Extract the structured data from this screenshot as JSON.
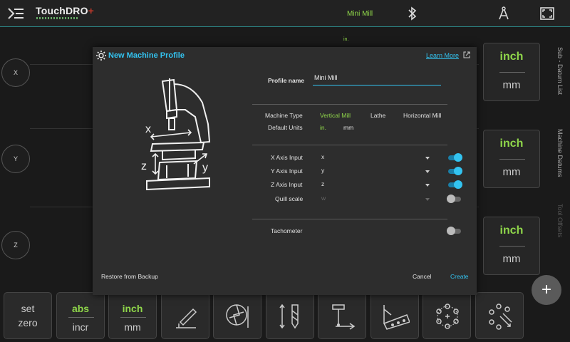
{
  "topbar": {
    "logo": "TouchDRO",
    "logo_plus": "+",
    "profile_name": "Mini Mill"
  },
  "axes": [
    "X",
    "Y",
    "Z"
  ],
  "units": [
    {
      "top": "inch",
      "bottom": "mm"
    },
    {
      "top": "inch",
      "bottom": "mm"
    },
    {
      "top": "inch",
      "bottom": "mm"
    }
  ],
  "side_tabs": [
    "Sub - Datum List",
    "Machine Datums",
    "Tool Offsets"
  ],
  "fab_label": "+",
  "toolbar": {
    "set_zero": {
      "l1": "set",
      "l2": "zero"
    },
    "abs_incr": {
      "l1": "abs",
      "l2": "incr"
    },
    "inch_mm": {
      "l1": "inch",
      "l2": "mm"
    }
  },
  "dialog": {
    "title": "New Machine Profile",
    "learn_more": "Learn More",
    "profile_name_label": "Profile name",
    "profile_name_value": "Mini Mill",
    "machine_type_label": "Machine Type",
    "machine_types": [
      "Vertical Mill",
      "Lathe",
      "Horizontal Mill"
    ],
    "machine_type_selected": "Vertical Mill",
    "default_units_label": "Default Units",
    "units_options": [
      "in.",
      "mm"
    ],
    "units_selected": "in.",
    "inputs": [
      {
        "label": "X Axis Input",
        "value": "x",
        "enabled": true
      },
      {
        "label": "Y Axis Input",
        "value": "y",
        "enabled": true
      },
      {
        "label": "Z Axis Input",
        "value": "z",
        "enabled": true
      },
      {
        "label": "Quill scale",
        "value": "w",
        "enabled": false
      }
    ],
    "tachometer_label": "Tachometer",
    "tachometer_enabled": false,
    "restore_label": "Restore from Backup",
    "cancel_label": "Cancel",
    "create_label": "Create",
    "diagram_labels": {
      "x": "x",
      "y": "y",
      "z": "z"
    }
  },
  "background_hint": "in.",
  "colors": {
    "accent": "#33c3f0",
    "selected_green": "#8fd64a"
  }
}
